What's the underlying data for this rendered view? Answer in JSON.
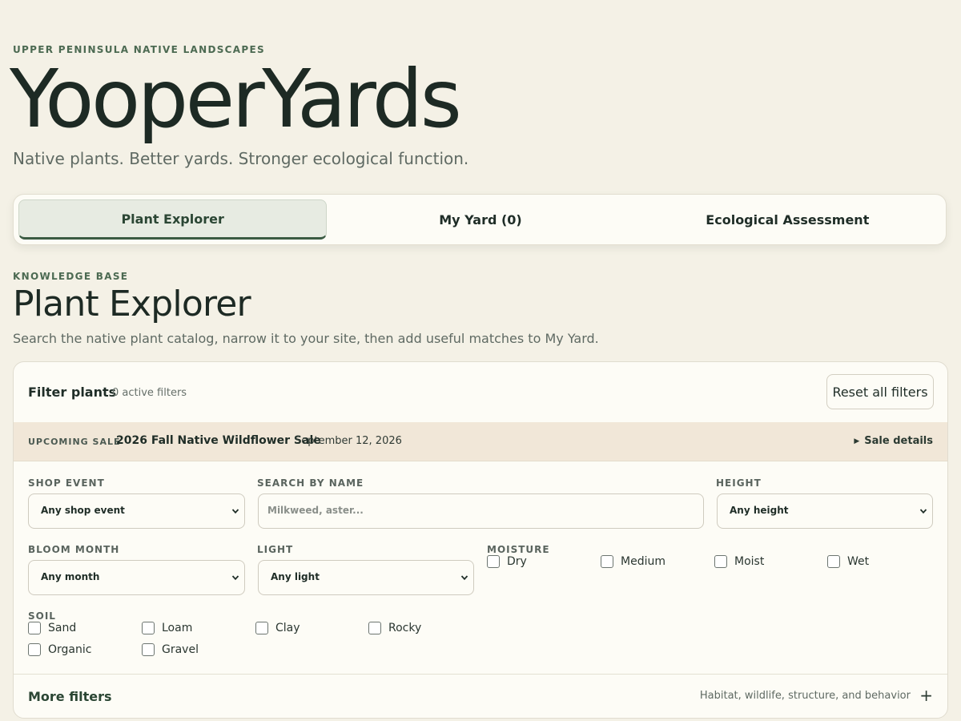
{
  "header": {
    "eyebrow": "UPPER PENINSULA NATIVE LANDSCAPES",
    "brand": "YooperYards",
    "tagline": "Native plants. Better yards. Stronger ecological function."
  },
  "tabs": [
    {
      "label": "Plant Explorer",
      "active": true
    },
    {
      "label": "My Yard (0)",
      "active": false
    },
    {
      "label": "Ecological Assessment",
      "active": false
    }
  ],
  "section": {
    "eyebrow": "KNOWLEDGE BASE",
    "title": "Plant Explorer",
    "description": "Search the native plant catalog, narrow it to your site, then add useful matches to My Yard."
  },
  "filters": {
    "title": "Filter plants",
    "active_count": "0 active filters",
    "reset_label": "Reset all filters",
    "sale": {
      "label": "UPCOMING SALE",
      "name": "2026 Fall Native Wildflower Sale",
      "date": "September 12, 2026",
      "details_label": "Sale details"
    },
    "shop_event": {
      "label": "SHOP EVENT",
      "value": "Any shop event"
    },
    "search": {
      "label": "SEARCH BY NAME",
      "placeholder": "Milkweed, aster..."
    },
    "height": {
      "label": "HEIGHT",
      "value": "Any height"
    },
    "bloom_month": {
      "label": "BLOOM MONTH",
      "value": "Any month"
    },
    "light": {
      "label": "LIGHT",
      "value": "Any light"
    },
    "moisture": {
      "label": "MOISTURE",
      "options": [
        "Dry",
        "Medium",
        "Moist",
        "Wet"
      ]
    },
    "soil": {
      "label": "SOIL",
      "options": [
        "Sand",
        "Loam",
        "Clay",
        "Rocky",
        "Organic",
        "Gravel"
      ]
    },
    "more": {
      "title": "More filters",
      "description": "Habitat, wildlife, structure, and behavior",
      "expand_icon": "plus-icon"
    }
  },
  "colors": {
    "background": "#f4f1e6",
    "accent": "#3b5b43",
    "sale_band": "#f1e7d8"
  }
}
